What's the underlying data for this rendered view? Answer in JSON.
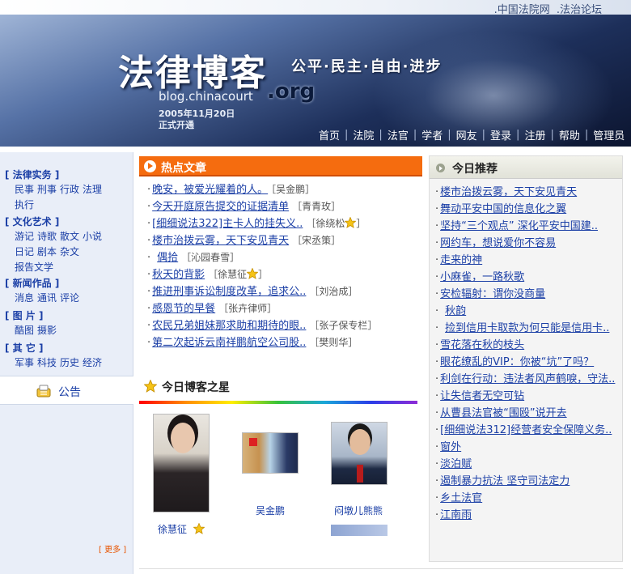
{
  "top_links": [
    ".中国法院网",
    ".法治论坛"
  ],
  "banner": {
    "title": "法律博客",
    "slogan": "公平·民主·自由·进步",
    "domain": "blog.chinacourt",
    "domain_suffix": ".org",
    "open_date": "2005年11月20日",
    "open_note": "正式开通"
  },
  "nav": [
    "首页",
    "法院",
    "法官",
    "学者",
    "网友",
    "登录",
    "注册",
    "帮助",
    "管理员"
  ],
  "sidebar": {
    "categories": [
      {
        "title": "[ 法律实务 ]",
        "links": [
          "民事",
          "刑事",
          "行政",
          "法理",
          "执行"
        ]
      },
      {
        "title": "[ 文化艺术 ]",
        "links": [
          "游记",
          "诗歌",
          "散文",
          "小说",
          "日记",
          "剧本",
          "杂文",
          "报告文学"
        ]
      },
      {
        "title": "[ 新闻作品 ]",
        "links": [
          "消息",
          "通讯",
          "评论"
        ]
      },
      {
        "title": "[ 图 片 ]",
        "links": [
          "酷图",
          "摄影"
        ]
      },
      {
        "title": "[ 其 它 ]",
        "links": [
          "军事",
          "科技",
          "历史",
          "经济"
        ]
      }
    ],
    "announcement": "公告",
    "more": "[ 更多 ]"
  },
  "hot": {
    "title": "热点文章",
    "items": [
      {
        "title": "晚安，被爱光耀着的人。",
        "author": "［吴金鹏］",
        "star": false
      },
      {
        "title": "今天开庭原告提交的证据清单",
        "author": "［青青玫］",
        "star": false
      },
      {
        "title": "[细细说法322]主卡人的挂失义..",
        "author": "［徐绕松",
        "star": true,
        "after": "］"
      },
      {
        "title": "楼市治拨云雾，天下安见青天",
        "author": "［宋丞策］",
        "star": false
      },
      {
        "title": "偶拾",
        "author": "［沁园春雪］",
        "star": false
      },
      {
        "title": "秋天的背影",
        "author": "［徐慧征",
        "star": true,
        "after": "］"
      },
      {
        "title": "推进刑事诉讼制度改革，追求公..",
        "author": "［刘治成］",
        "star": false
      },
      {
        "title": "感恩节的早餐",
        "author": "［张卉律师］",
        "star": false
      },
      {
        "title": "农民兄弟姐妹那求助和期待的眼..",
        "author": "［张子保专栏］",
        "star": false
      },
      {
        "title": "第二次起诉云南祥鹏航空公司股..",
        "author": "［樊则华］",
        "star": false
      }
    ]
  },
  "stars": {
    "title": "今日博客之星",
    "names": [
      "徐慧征",
      "吴金鹏",
      "闷墩儿熊熊"
    ]
  },
  "recommend": {
    "title": "今日推荐",
    "items": [
      "楼市治拨云雾，天下安见青天",
      "舞动平安中国的信息化之翼",
      "坚持“三个观点” 深化平安中国建..",
      "网约车，想说爱你不容易",
      "走来的神",
      "小麻雀，一路秋歌",
      "安检辐射：谓你没商量",
      "秋韵",
      "捡到信用卡取款为何只能是信用卡..",
      "雪花落在秋的枝头",
      "眼花缭乱的VIP：你被“坑”了吗？",
      "利剑在行动：违法者风声鹤唳，守法..",
      "让失信者无空可钻",
      "从曹县法官被“围殴”说开去",
      "[细细说法312]经营者安全保障义务..",
      "窗外",
      "淡泊赋",
      "遏制暴力抗法 坚守司法定力",
      "乡土法官",
      "江南雨"
    ]
  },
  "colors": {
    "accent": "#f56c0f",
    "link": "#1b3fa6",
    "sidebar_bg": "#e9eef8",
    "banner_dark": "#1d2f5a"
  }
}
